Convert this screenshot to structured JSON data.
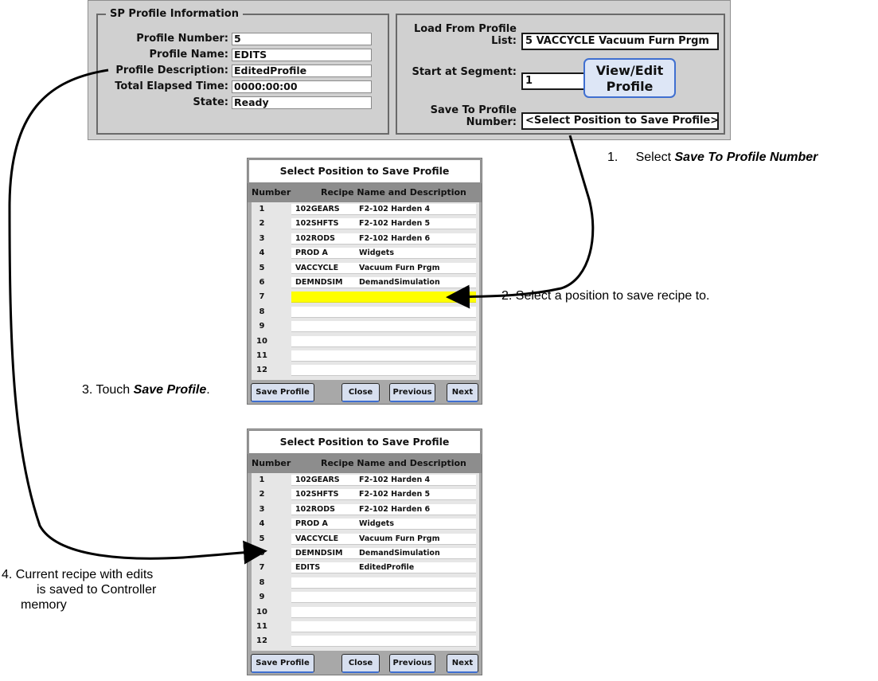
{
  "profile_info": {
    "legend": "SP Profile Information",
    "rows": [
      {
        "label": "Profile Number:",
        "value": "5"
      },
      {
        "label": "Profile Name:",
        "value": "EDITS"
      },
      {
        "label": "Profile Description:",
        "value": "EditedProfile"
      },
      {
        "label": "Total Elapsed Time:",
        "value": "0000:00:00"
      },
      {
        "label": "State:",
        "value": "Ready"
      }
    ]
  },
  "load_panel": {
    "load_from_label": "Load From Profile List:",
    "load_from_value": "5   VACCYCLE    Vacuum Furn Prgm",
    "start_segment_label": "Start at Segment:",
    "start_segment_value": "1",
    "view_edit_button": "View/Edit Profile",
    "save_to_label": "Save To Profile Number:",
    "save_to_value": "<Select Position to Save Profile>"
  },
  "dialog_1": {
    "title": "Select Position to Save Profile",
    "header_number": "Number",
    "header_recipe": "Recipe Name and Description",
    "rows": [
      {
        "num": "1",
        "name": "102GEARS",
        "desc": "F2-102 Harden 4"
      },
      {
        "num": "2",
        "name": "102SHFTS",
        "desc": "F2-102 Harden 5"
      },
      {
        "num": "3",
        "name": "102RODS",
        "desc": "F2-102 Harden 6"
      },
      {
        "num": "4",
        "name": "PROD A",
        "desc": "Widgets"
      },
      {
        "num": "5",
        "name": "VACCYCLE",
        "desc": "Vacuum Furn Prgm"
      },
      {
        "num": "6",
        "name": "DEMNDSIM",
        "desc": "DemandSimulation"
      },
      {
        "num": "7",
        "name": "",
        "desc": ""
      },
      {
        "num": "8",
        "name": "",
        "desc": ""
      },
      {
        "num": "9",
        "name": "",
        "desc": ""
      },
      {
        "num": "10",
        "name": "",
        "desc": ""
      },
      {
        "num": "11",
        "name": "",
        "desc": ""
      },
      {
        "num": "12",
        "name": "",
        "desc": ""
      }
    ],
    "buttons": {
      "save": "Save Profile",
      "close": "Close",
      "previous": "Previous",
      "next": "Next"
    }
  },
  "dialog_2": {
    "title": "Select Position to Save Profile",
    "header_number": "Number",
    "header_recipe": "Recipe Name and Description",
    "rows": [
      {
        "num": "1",
        "name": "102GEARS",
        "desc": "F2-102 Harden 4"
      },
      {
        "num": "2",
        "name": "102SHFTS",
        "desc": "F2-102 Harden 5"
      },
      {
        "num": "3",
        "name": "102RODS",
        "desc": "F2-102 Harden 6"
      },
      {
        "num": "4",
        "name": "PROD A",
        "desc": "Widgets"
      },
      {
        "num": "5",
        "name": "VACCYCLE",
        "desc": "Vacuum Furn Prgm"
      },
      {
        "num": "6",
        "name": "DEMNDSIM",
        "desc": "DemandSimulation"
      },
      {
        "num": "7",
        "name": "EDITS",
        "desc": "EditedProfile"
      },
      {
        "num": "8",
        "name": "",
        "desc": ""
      },
      {
        "num": "9",
        "name": "",
        "desc": ""
      },
      {
        "num": "10",
        "name": "",
        "desc": ""
      },
      {
        "num": "11",
        "name": "",
        "desc": ""
      },
      {
        "num": "12",
        "name": "",
        "desc": ""
      }
    ],
    "buttons": {
      "save": "Save Profile",
      "close": "Close",
      "previous": "Previous",
      "next": "Next"
    }
  },
  "callouts": {
    "step1_prefix": "1.",
    "step1_text": "Select ",
    "step1_emphasis": "Save To Profile Number",
    "step2": "2. Select a position to save recipe to.",
    "step3_text": "3. Touch ",
    "step3_emphasis": "Save Profile",
    "step3_suffix": ".",
    "step4_line1": "4. Current recipe with edits",
    "step4_line2": "is saved to Controller",
    "step4_line3": "memory"
  },
  "colors": {
    "highlight_row": "#ffff00",
    "button_accent": "#3f6fd0",
    "panel_bg": "#d0d0d0"
  }
}
